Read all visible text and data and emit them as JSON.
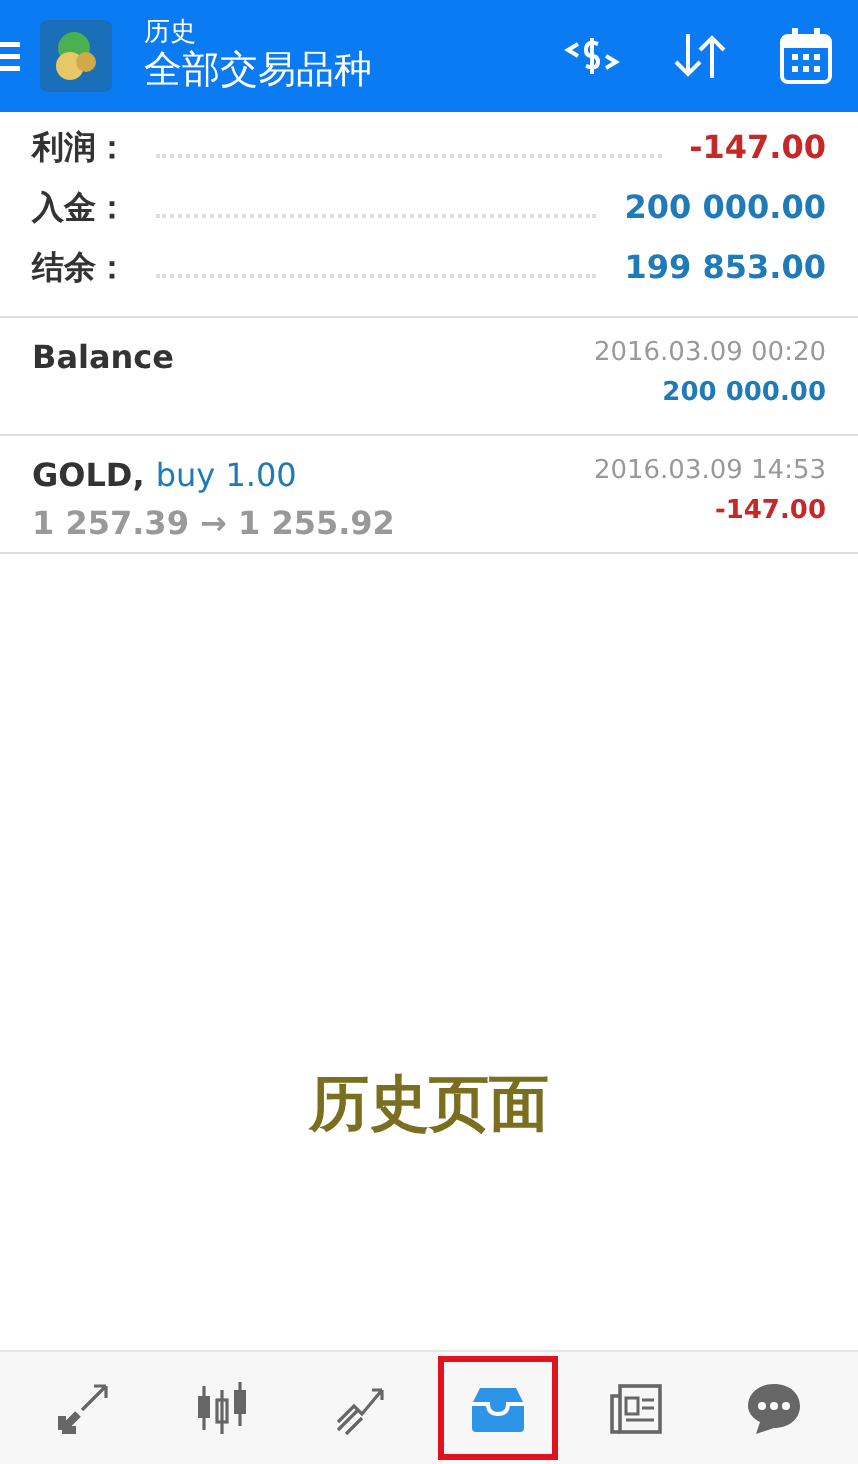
{
  "header": {
    "title": "历史",
    "subtitle": "全部交易品种"
  },
  "summary": [
    {
      "label": "利润：",
      "value": "-147.00",
      "color": "#c62828"
    },
    {
      "label": "入金：",
      "value": "200 000.00",
      "color": "#1f7ab8"
    },
    {
      "label": "结余：",
      "value": "199 853.00",
      "color": "#1f7ab8"
    }
  ],
  "deals": [
    {
      "kind": "balance",
      "title": "Balance",
      "time": "2016.03.09 00:20",
      "amount": "200 000.00",
      "color": "#1f7ab8"
    },
    {
      "kind": "trade",
      "symbol": "GOLD,",
      "action": "buy 1.00",
      "prices": "1 257.39 → 1 255.92",
      "time": "2016.03.09 14:53",
      "amount": "-147.00",
      "color": "#c62828"
    }
  ],
  "caption": "历史页面",
  "nav": [
    {
      "selected": false
    },
    {
      "selected": false
    },
    {
      "selected": false
    },
    {
      "selected": true
    },
    {
      "selected": false
    },
    {
      "selected": false
    }
  ]
}
